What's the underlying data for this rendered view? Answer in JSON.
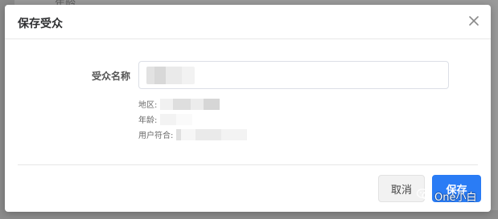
{
  "backdrop": {
    "text": "年龄"
  },
  "modal": {
    "title": "保存受众",
    "close_icon": "close-icon"
  },
  "form": {
    "audience_name_label": "受众名称",
    "audience_name_value": "",
    "info": {
      "region_label": "地区:",
      "age_label": "年龄:",
      "user_match_label": "用户符合:"
    }
  },
  "footer": {
    "cancel_label": "取消",
    "save_label": "保存"
  },
  "watermark": {
    "icon": "wechat-icon",
    "text": "One小白"
  },
  "colors": {
    "primary": "#2a7cf5",
    "overlay": "#9a9a9a"
  }
}
